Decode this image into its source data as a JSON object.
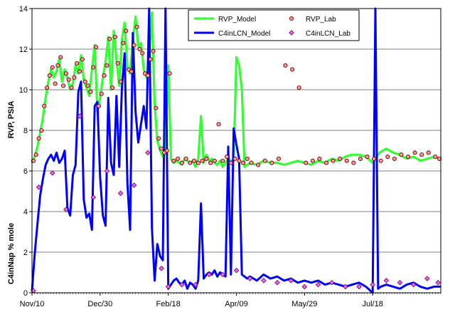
{
  "chart_data": {
    "type": "line",
    "xlabel": "",
    "y_label_top": "RVP, PSIA",
    "y_label_bottom": "C4inNap % mole",
    "ylim": [
      0,
      14
    ],
    "grid": true,
    "legend_placement": "top-right",
    "x_domain_days": [
      0,
      300
    ],
    "x_ticks": [
      {
        "day": 0,
        "label": "Nov/10"
      },
      {
        "day": 50,
        "label": "Dec/30"
      },
      {
        "day": 100,
        "label": "Feb/18"
      },
      {
        "day": 150,
        "label": "Apr/09"
      },
      {
        "day": 200,
        "label": "May/29"
      },
      {
        "day": 250,
        "label": "Jul/18"
      }
    ],
    "y_ticks": [
      0,
      2,
      4,
      6,
      8,
      10,
      12,
      14
    ],
    "series": [
      {
        "name": "RVP_Model",
        "kind": "line",
        "color": "#33ff33",
        "x": [
          0,
          2,
          4,
          6,
          8,
          10,
          12,
          14,
          16,
          18,
          20,
          22,
          24,
          26,
          28,
          30,
          32,
          34,
          36,
          38,
          40,
          42,
          44,
          46,
          48,
          50,
          52,
          54,
          56,
          58,
          60,
          62,
          64,
          66,
          68,
          70,
          72,
          74,
          76,
          78,
          80,
          82,
          84,
          86,
          88,
          90,
          92,
          94,
          96,
          98,
          100,
          102,
          104,
          106,
          108,
          110,
          112,
          114,
          116,
          118,
          120,
          122,
          124,
          126,
          128,
          130,
          132,
          134,
          136,
          138,
          140,
          142,
          144,
          146,
          148,
          150,
          152,
          154,
          156,
          158,
          160,
          165,
          170,
          175,
          180,
          185,
          190,
          195,
          200,
          205,
          210,
          215,
          220,
          225,
          230,
          235,
          240,
          245,
          250,
          255,
          260,
          265,
          270,
          275,
          280,
          285,
          290,
          295,
          300
        ],
        "y": [
          6.4,
          6.7,
          7.2,
          7.9,
          8.6,
          9.6,
          10.4,
          11.0,
          10.6,
          10.9,
          11.5,
          10.4,
          11.0,
          10.6,
          10.0,
          10.3,
          11.2,
          10.8,
          11.7,
          10.5,
          10.1,
          9.7,
          11.0,
          12.2,
          8.9,
          9.6,
          10.6,
          11.4,
          12.6,
          10.0,
          12.9,
          11.5,
          10.2,
          12.5,
          13.3,
          11.1,
          10.8,
          12.4,
          13.6,
          12.1,
          12.3,
          11.0,
          10.6,
          11.7,
          13.8,
          9.3,
          7.5,
          7.0,
          6.7,
          7.3,
          11.2,
          6.6,
          6.4,
          6.5,
          6.4,
          6.3,
          6.6,
          6.5,
          6.4,
          6.5,
          6.2,
          6.6,
          8.7,
          6.4,
          6.8,
          6.5,
          6.6,
          6.4,
          6.3,
          6.5,
          6.2,
          6.4,
          6.6,
          6.5,
          6.5,
          11.6,
          11.2,
          10.0,
          6.2,
          6.3,
          6.4,
          6.3,
          6.5,
          6.4,
          6.4,
          6.3,
          6.4,
          6.5,
          6.4,
          6.3,
          6.5,
          6.4,
          6.6,
          6.5,
          6.7,
          6.8,
          6.8,
          6.7,
          6.4,
          6.9,
          7.1,
          6.9,
          6.8,
          6.6,
          6.7,
          6.5,
          6.6,
          6.7,
          6.6
        ]
      },
      {
        "name": "RVP_Lab",
        "kind": "points",
        "color": "#ff9999",
        "edge": "#660000",
        "x": [
          1,
          3,
          5,
          7,
          9,
          11,
          13,
          15,
          17,
          19,
          21,
          23,
          25,
          27,
          29,
          31,
          33,
          35,
          37,
          39,
          41,
          43,
          45,
          47,
          49,
          51,
          53,
          55,
          57,
          59,
          61,
          63,
          65,
          67,
          69,
          71,
          73,
          75,
          77,
          79,
          81,
          83,
          85,
          87,
          89,
          91,
          93,
          95,
          97,
          99,
          101,
          104,
          107,
          110,
          113,
          116,
          119,
          122,
          125,
          128,
          131,
          134,
          137,
          140,
          143,
          146,
          149,
          152,
          155,
          158,
          161,
          166,
          171,
          176,
          181,
          186,
          191,
          196,
          201,
          206,
          211,
          216,
          221,
          226,
          231,
          236,
          241,
          246,
          251,
          256,
          261,
          266,
          271,
          276,
          281,
          286,
          291,
          296,
          299
        ],
        "y": [
          6.5,
          6.8,
          7.6,
          8.0,
          9.2,
          10.1,
          10.7,
          11.1,
          10.3,
          11.2,
          11.6,
          10.2,
          10.8,
          10.5,
          10.1,
          10.6,
          11.3,
          10.9,
          11.5,
          10.4,
          10.2,
          9.9,
          11.1,
          12.1,
          9.2,
          9.8,
          10.7,
          11.2,
          12.5,
          10.1,
          12.6,
          11.3,
          10.4,
          12.3,
          12.9,
          11.0,
          10.9,
          12.2,
          13.1,
          12.0,
          11.8,
          10.8,
          10.7,
          11.5,
          11.9,
          9.1,
          7.6,
          7.1,
          6.9,
          7.0,
          10.8,
          6.5,
          6.6,
          6.4,
          6.6,
          6.4,
          6.5,
          6.4,
          6.5,
          6.6,
          6.4,
          6.5,
          8.3,
          6.5,
          6.7,
          6.4,
          6.6,
          6.5,
          6.4,
          6.6,
          6.4,
          6.3,
          6.5,
          6.4,
          6.6,
          11.2,
          11.0,
          10.1,
          6.4,
          6.5,
          6.6,
          6.4,
          6.5,
          6.6,
          6.5,
          6.4,
          6.6,
          6.7,
          6.6,
          6.5,
          6.7,
          6.6,
          6.8,
          6.7,
          6.9,
          6.8,
          6.9,
          6.7,
          6.6
        ]
      },
      {
        "name": "C4inLCN_Model",
        "kind": "line",
        "color": "#0000ff",
        "x": [
          0,
          2,
          4,
          6,
          8,
          10,
          12,
          14,
          16,
          18,
          20,
          22,
          24,
          26,
          28,
          30,
          32,
          34,
          36,
          38,
          40,
          42,
          44,
          46,
          48,
          50,
          52,
          54,
          56,
          58,
          60,
          62,
          64,
          66,
          68,
          70,
          72,
          74,
          76,
          78,
          80,
          82,
          84,
          86,
          88,
          90,
          92,
          94,
          96,
          98,
          100,
          102,
          104,
          106,
          108,
          110,
          112,
          114,
          116,
          118,
          120,
          122,
          124,
          126,
          128,
          130,
          132,
          134,
          136,
          138,
          140,
          142,
          144,
          146,
          148,
          150,
          152,
          154,
          156,
          158,
          160,
          165,
          170,
          175,
          180,
          185,
          190,
          195,
          200,
          205,
          210,
          215,
          220,
          225,
          230,
          235,
          240,
          245,
          250,
          252,
          254,
          256,
          260,
          265,
          270,
          275,
          280,
          285,
          290,
          295,
          300
        ],
        "y": [
          0.1,
          1.9,
          3.4,
          4.8,
          5.6,
          6.3,
          6.6,
          6.8,
          6.5,
          6.9,
          6.4,
          6.6,
          7.0,
          4.2,
          3.8,
          5.8,
          6.3,
          9.9,
          10.4,
          4.6,
          3.7,
          3.9,
          3.1,
          9.2,
          9.4,
          5.7,
          3.8,
          3.3,
          9.6,
          6.4,
          5.8,
          9.7,
          6.2,
          10.1,
          11.8,
          5.4,
          3.1,
          12.8,
          8.9,
          7.4,
          8.3,
          9.2,
          8.1,
          14.0,
          3.2,
          0.6,
          2.4,
          1.8,
          1.6,
          14.0,
          0.2,
          0.4,
          0.6,
          0.7,
          0.5,
          0.4,
          0.6,
          0.2,
          0.5,
          0.4,
          0.2,
          0.6,
          4.4,
          0.7,
          0.9,
          1.0,
          0.9,
          1.1,
          0.8,
          1.0,
          0.9,
          0.8,
          7.2,
          0.9,
          8.1,
          7.3,
          6.6,
          0.9,
          0.8,
          0.7,
          0.8,
          0.6,
          0.9,
          0.7,
          0.8,
          0.6,
          0.7,
          0.5,
          0.6,
          0.5,
          0.6,
          0.4,
          0.5,
          0.4,
          0.3,
          0.4,
          0.5,
          0.3,
          0.0,
          14.0,
          0.2,
          0.3,
          0.4,
          0.3,
          0.2,
          0.4,
          0.5,
          0.3,
          0.2,
          0.3,
          0.3
        ]
      },
      {
        "name": "C4inLCN_Lab",
        "kind": "points",
        "color": "#ee66ee",
        "edge": "#660066",
        "x": [
          1,
          5,
          15,
          25,
          35,
          45,
          55,
          65,
          75,
          85,
          95,
          100,
          110,
          120,
          130,
          140,
          150,
          160,
          170,
          180,
          190,
          200,
          210,
          220,
          230,
          240,
          250,
          260,
          270,
          280,
          290,
          298
        ],
        "y": [
          0.1,
          5.2,
          5.9,
          4.1,
          8.7,
          4.7,
          6.0,
          4.9,
          5.3,
          6.9,
          1.2,
          0.3,
          0.4,
          0.4,
          0.9,
          0.9,
          1.1,
          0.7,
          0.6,
          0.5,
          0.6,
          0.3,
          0.4,
          0.5,
          0.3,
          0.3,
          0.4,
          0.6,
          0.5,
          0.4,
          0.7,
          0.5
        ]
      }
    ]
  }
}
